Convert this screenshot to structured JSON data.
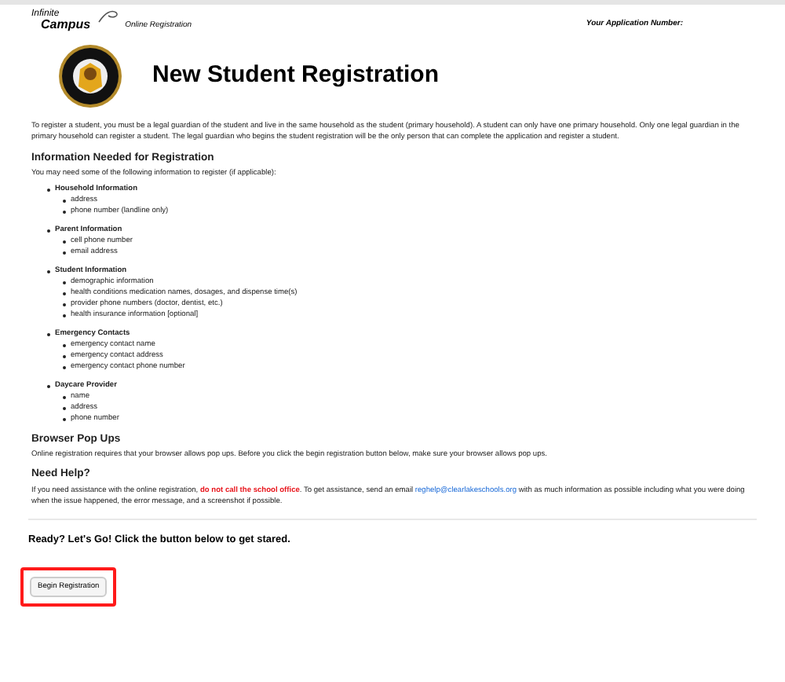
{
  "header": {
    "brand_top": "Infinite",
    "brand_bottom": "Campus",
    "product": "Online Registration",
    "application_label": "Your Application Number:"
  },
  "title": "New Student Registration",
  "intro": "To register a student, you must be a legal guardian of the student and live in the same household as the student (primary household). A student can only have one primary household. Only one legal guardian in the primary household can register a student. The legal guardian who begins the student registration will be the only person that can complete the application and register a student.",
  "info_section": {
    "heading": "Information Needed for Registration",
    "lead": "You may need some of the following information to register (if applicable):",
    "groups": [
      {
        "label": "Household Information",
        "children": [
          "address",
          "phone number (landline only)"
        ]
      },
      {
        "label": "Parent Information",
        "children": [
          "cell phone number",
          "email address"
        ]
      },
      {
        "label": "Student Information",
        "children": [
          "demographic information",
          "health conditions medication names, dosages, and dispense time(s)",
          "provider phone numbers (doctor, dentist, etc.)",
          "health insurance information [optional]"
        ]
      },
      {
        "label": "Emergency Contacts",
        "children": [
          "emergency contact name",
          "emergency contact address",
          "emergency contact phone number"
        ]
      },
      {
        "label": "Daycare Provider",
        "children": [
          "name",
          "address",
          "phone number"
        ]
      }
    ]
  },
  "popups": {
    "heading": "Browser Pop Ups",
    "text": "Online registration requires that your browser allows pop ups. Before you click the begin registration button below, make sure your browser allows pop ups."
  },
  "help": {
    "heading": "Need Help?",
    "text_before": "If you need assistance with the online registration, ",
    "warning": "do not call the school office",
    "text_middle": ". To get assistance, send an email ",
    "email": "reghelp@clearlakeschools.org",
    "text_after": " with as much information as possible including what you were doing when the issue happened, the error message, and a screenshot if possible."
  },
  "ready": "Ready? Let's Go! Click the button below to get stared.",
  "button": {
    "label": "Begin Registration",
    "highlighted": true
  }
}
